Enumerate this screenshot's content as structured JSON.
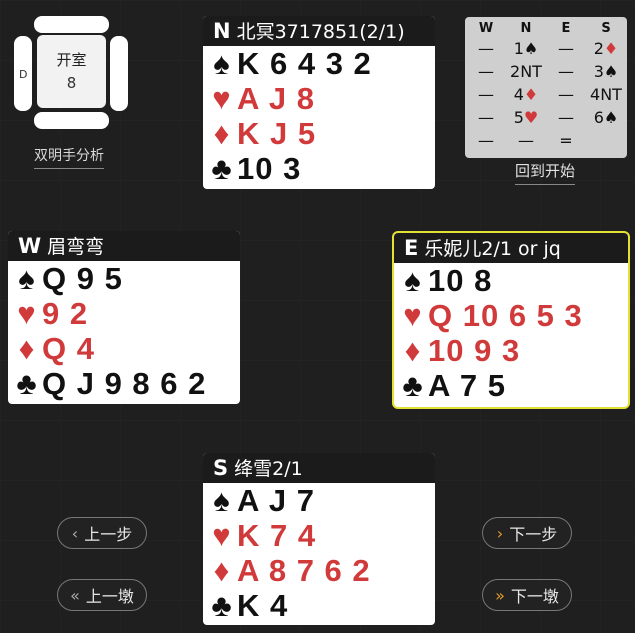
{
  "table": {
    "seat_label_w": "D",
    "room_label": "开室",
    "room_number": "8",
    "analysis_link": "双明手分析"
  },
  "hands": {
    "north": {
      "dir": "N",
      "player": "北冥3717851(2/1)",
      "spades": "K 6 4 3 2",
      "hearts": "A J 8",
      "diamonds": "K J 5",
      "clubs": "10 3"
    },
    "west": {
      "dir": "W",
      "player": "眉弯弯",
      "spades": "Q 9 5",
      "hearts": "9 2",
      "diamonds": "Q 4",
      "clubs": "Q J 9 8 6 2"
    },
    "east": {
      "dir": "E",
      "player": "乐妮儿2/1 or jq",
      "spades": "10 8",
      "hearts": "Q 10 6 5 3",
      "diamonds": "10 9 3",
      "clubs": "A 7 5"
    },
    "south": {
      "dir": "S",
      "player": "绛雪2/1",
      "spades": "A J 7",
      "hearts": "K 7 4",
      "diamonds": "A 8 7 6 2",
      "clubs": "K 4"
    }
  },
  "suit_symbols": {
    "spades": "♠",
    "hearts": "♥",
    "diamonds": "♦",
    "clubs": "♣"
  },
  "bidding": {
    "headers": [
      "W",
      "N",
      "E",
      "S"
    ],
    "rows": [
      [
        "—",
        "1♠",
        "—",
        "2♦"
      ],
      [
        "—",
        "2NT",
        "—",
        "3♠"
      ],
      [
        "—",
        "4♦",
        "—",
        "4NT"
      ],
      [
        "—",
        "5♥",
        "—",
        "6♠"
      ],
      [
        "—",
        "—",
        "=",
        ""
      ]
    ],
    "back_link": "回到开始"
  },
  "nav": {
    "prev_step": "上一步",
    "prev_trick": "上一墩",
    "next_step": "下一步",
    "next_trick": "下一墩"
  },
  "colors": {
    "red_suit": "#d13a3a",
    "active_border": "#e6e034",
    "accent": "#e69a2e"
  }
}
